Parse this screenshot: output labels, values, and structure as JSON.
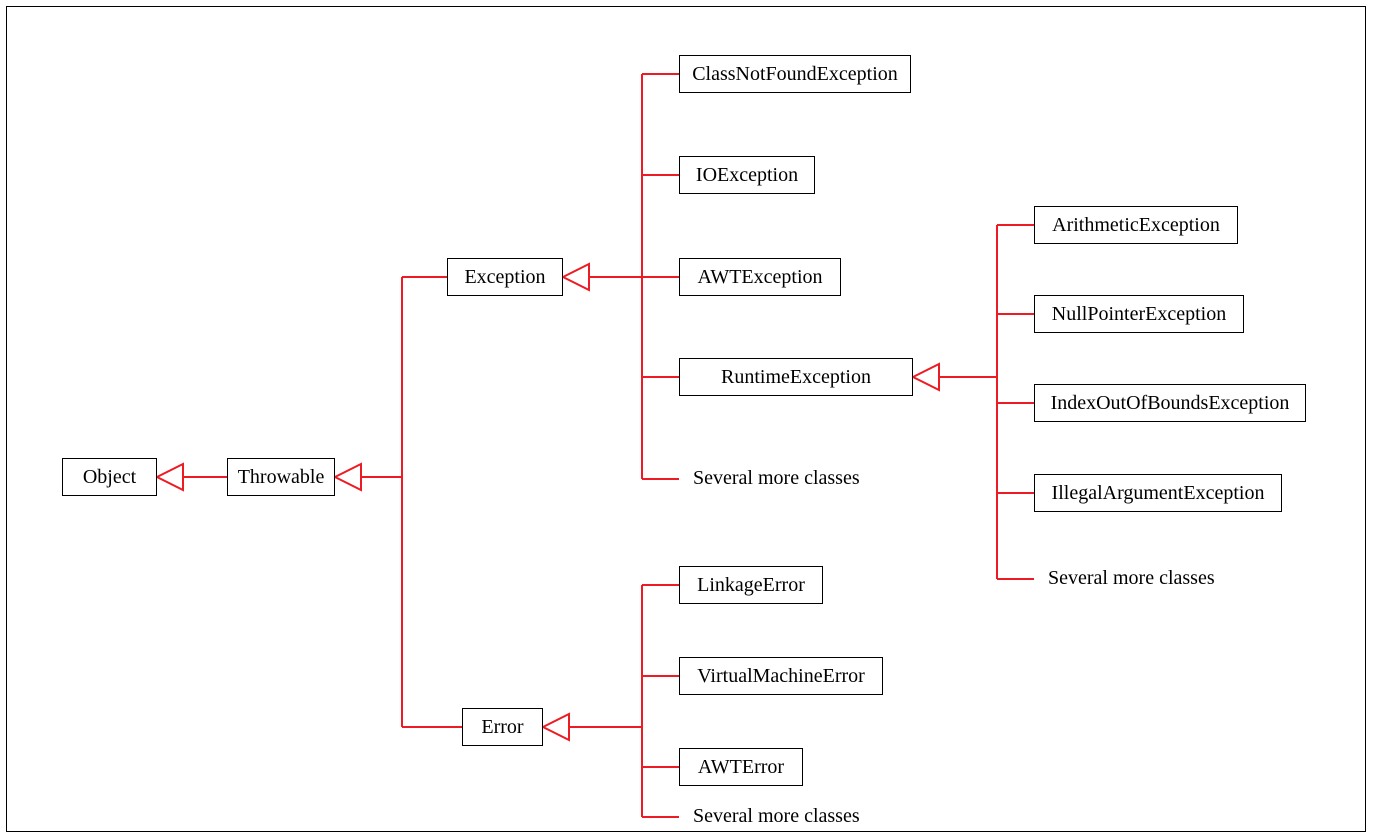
{
  "colors": {
    "connector": "#ed1c24",
    "border": "#000000",
    "background": "#ffffff"
  },
  "nodes": {
    "object": "Object",
    "throwable": "Throwable",
    "exception": "Exception",
    "error": "Error",
    "classNotFound": "ClassNotFoundException",
    "ioException": "IOException",
    "awtException": "AWTException",
    "runtimeException": "RuntimeException",
    "linkageError": "LinkageError",
    "virtualMachineError": "VirtualMachineError",
    "awtError": "AWTError",
    "arithmeticException": "ArithmeticException",
    "nullPointerException": "NullPointerException",
    "indexOutOfBoundsException": "IndexOutOfBoundsException",
    "illegalArgumentException": "IllegalArgumentException"
  },
  "moreLabel": "Several more classes"
}
